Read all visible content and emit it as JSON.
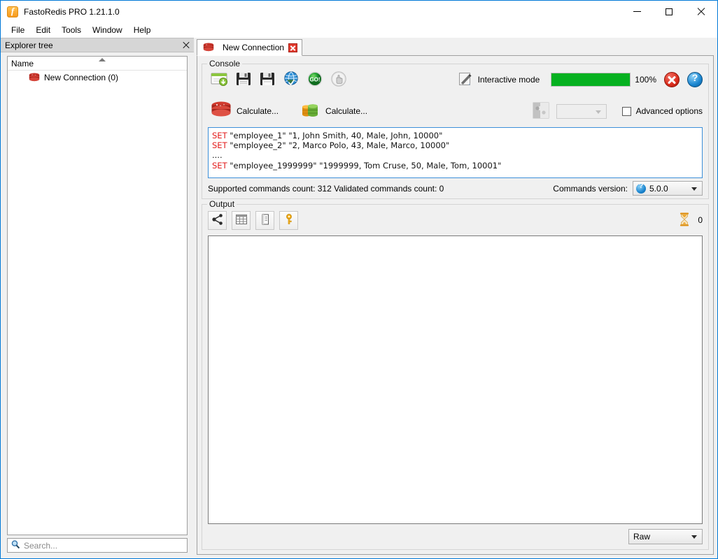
{
  "window": {
    "title": "FastoRedis PRO 1.21.1.0",
    "app_icon": "fastoredis-icon",
    "controls": {
      "minimize": "minimize",
      "maximize": "maximize",
      "close": "close"
    }
  },
  "menubar": {
    "items": [
      {
        "label": "File"
      },
      {
        "label": "Edit"
      },
      {
        "label": "Tools"
      },
      {
        "label": "Window"
      },
      {
        "label": "Help"
      }
    ]
  },
  "explorer": {
    "title": "Explorer tree",
    "column_header": "Name",
    "items": [
      {
        "label": "New Connection (0)",
        "icon": "redis-icon"
      }
    ],
    "search": {
      "placeholder": "Search...",
      "value": "",
      "icon": "search-icon"
    }
  },
  "tabs": [
    {
      "label": "New Connection",
      "icon": "redis-icon",
      "active": true,
      "close": "close-icon"
    }
  ],
  "console": {
    "group_title": "Console",
    "toolbar": [
      {
        "name": "load-from-file-button",
        "icon": "load-file-icon"
      },
      {
        "name": "save-button",
        "icon": "floppy-save-icon"
      },
      {
        "name": "save-as-button",
        "icon": "floppy-save-as-icon"
      },
      {
        "name": "connect-button",
        "icon": "globe-connect-icon"
      },
      {
        "name": "execute-button",
        "icon": "go-execute-icon"
      },
      {
        "name": "stop-button",
        "icon": "stop-hand-icon"
      }
    ],
    "interactive_mode": {
      "label": "Interactive mode",
      "icon": "pencil-edit-icon"
    },
    "progress": {
      "percent": 100,
      "percent_label": "100%",
      "color": "#06b120"
    },
    "stop_action": {
      "name": "cancel-button",
      "icon": "red-x-icon"
    },
    "help_action": {
      "name": "help-button",
      "icon": "blue-question-icon"
    },
    "calculate_buttons": [
      {
        "label": "Calculate...",
        "icon": "redis-stack-icon"
      },
      {
        "label": "Calculate...",
        "icon": "database-barrels-icon"
      }
    ],
    "module_icon": "puzzle-piece-icon",
    "module_combo": {
      "value": "",
      "disabled": true
    },
    "advanced_options": {
      "label": "Advanced options",
      "checked": false
    },
    "editor": {
      "lines": [
        {
          "keyword": "SET",
          "args": "\"employee_1\" \"1, John Smith, 40, Male, John, 10000\""
        },
        {
          "keyword": "SET",
          "args": "\"employee_2\" \"2, Marco Polo, 43, Male, Marco, 10000\""
        },
        {
          "keyword": "",
          "args": "...."
        },
        {
          "keyword": "SET",
          "args": "\"employee_1999999\" \"1999999, Tom Cruse, 50, Male, Tom, 10001\""
        }
      ]
    },
    "status": "Supported commands count: 312  Validated commands count: 0",
    "commands_version": {
      "label": "Commands version:",
      "value": "5.0.0",
      "icon": "blue-question-icon"
    }
  },
  "output": {
    "group_title": "Output",
    "toolbar": [
      {
        "name": "tree-view-button",
        "icon": "share-tree-icon"
      },
      {
        "name": "table-view-button",
        "icon": "table-icon"
      },
      {
        "name": "text-view-button",
        "icon": "text-document-icon"
      },
      {
        "name": "key-view-button",
        "icon": "key-icon"
      }
    ],
    "duration": {
      "icon": "hourglass-icon",
      "value": "0"
    },
    "content": "",
    "format_combo": {
      "value": "Raw",
      "options": [
        "Raw"
      ]
    }
  }
}
